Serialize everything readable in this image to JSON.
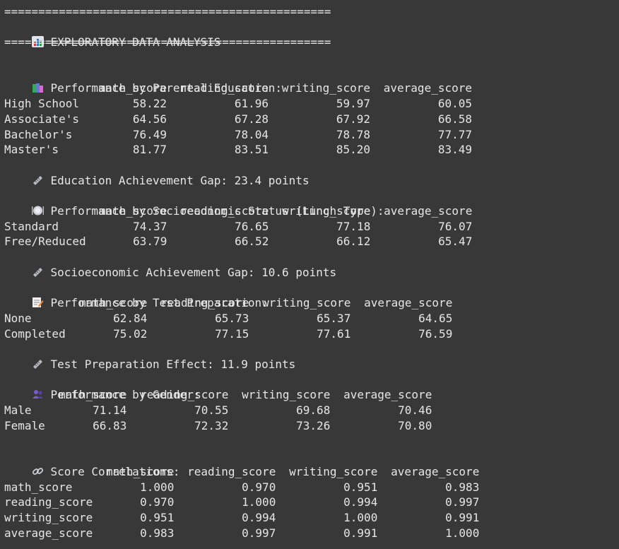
{
  "separator": "================================================",
  "title": "EXPLORATORY DATA ANALYSIS",
  "sections": {
    "parental": {
      "header": "Performance by Parental Education:",
      "columns": [
        "math_score",
        "reading_score",
        "writing_score",
        "average_score"
      ],
      "rows": [
        {
          "label": "High School",
          "values": [
            "58.22",
            "61.96",
            "59.97",
            "60.05"
          ]
        },
        {
          "label": "Associate's",
          "values": [
            "64.56",
            "67.28",
            "67.92",
            "66.58"
          ]
        },
        {
          "label": "Bachelor's",
          "values": [
            "76.49",
            "78.04",
            "78.78",
            "77.77"
          ]
        },
        {
          "label": "Master's",
          "values": [
            "81.77",
            "83.51",
            "85.20",
            "83.49"
          ]
        }
      ],
      "footer": "Education Achievement Gap: 23.4 points"
    },
    "lunch": {
      "header": "Performance by Socioeconomic Status (Lunch Type):",
      "columns": [
        "math_score",
        "reading_score",
        "writing_score",
        "average_score"
      ],
      "rows": [
        {
          "label": "Standard",
          "values": [
            "74.37",
            "76.65",
            "77.18",
            "76.07"
          ]
        },
        {
          "label": "Free/Reduced",
          "values": [
            "63.79",
            "66.52",
            "66.12",
            "65.47"
          ]
        }
      ],
      "footer": "Socioeconomic Achievement Gap: 10.6 points"
    },
    "prep": {
      "header": "Performance by Test Preparation:",
      "columns": [
        "math_score",
        "reading_score",
        "writing_score",
        "average_score"
      ],
      "rows": [
        {
          "label": "None",
          "values": [
            "62.84",
            "65.73",
            "65.37",
            "64.65"
          ]
        },
        {
          "label": "Completed",
          "values": [
            "75.02",
            "77.15",
            "77.61",
            "76.59"
          ]
        }
      ],
      "footer": "Test Preparation Effect: 11.9 points"
    },
    "gender": {
      "header": "Performance by Gender:",
      "columns": [
        "math_score",
        "reading_score",
        "writing_score",
        "average_score"
      ],
      "rows": [
        {
          "label": "Male",
          "values": [
            "71.14",
            "70.55",
            "69.68",
            "70.46"
          ]
        },
        {
          "label": "Female",
          "values": [
            "66.83",
            "72.32",
            "73.26",
            "70.80"
          ]
        }
      ]
    },
    "corr": {
      "header": "Score Correlations:",
      "columns": [
        "math_score",
        "reading_score",
        "writing_score",
        "average_score"
      ],
      "rows": [
        {
          "label": "math_score",
          "values": [
            "1.000",
            "0.970",
            "0.951",
            "0.983"
          ]
        },
        {
          "label": "reading_score",
          "values": [
            "0.970",
            "1.000",
            "0.994",
            "0.997"
          ]
        },
        {
          "label": "writing_score",
          "values": [
            "0.951",
            "0.994",
            "1.000",
            "0.991"
          ]
        },
        {
          "label": "average_score",
          "values": [
            "0.983",
            "0.997",
            "0.991",
            "1.000"
          ]
        }
      ]
    }
  },
  "icons": {
    "title": "bar-chart-icon",
    "parental": "books-icon",
    "lunch": "plate-icon",
    "prep": "memo-icon",
    "gender": "people-icon",
    "corr": "link-icon",
    "footer": "ruler-icon"
  }
}
